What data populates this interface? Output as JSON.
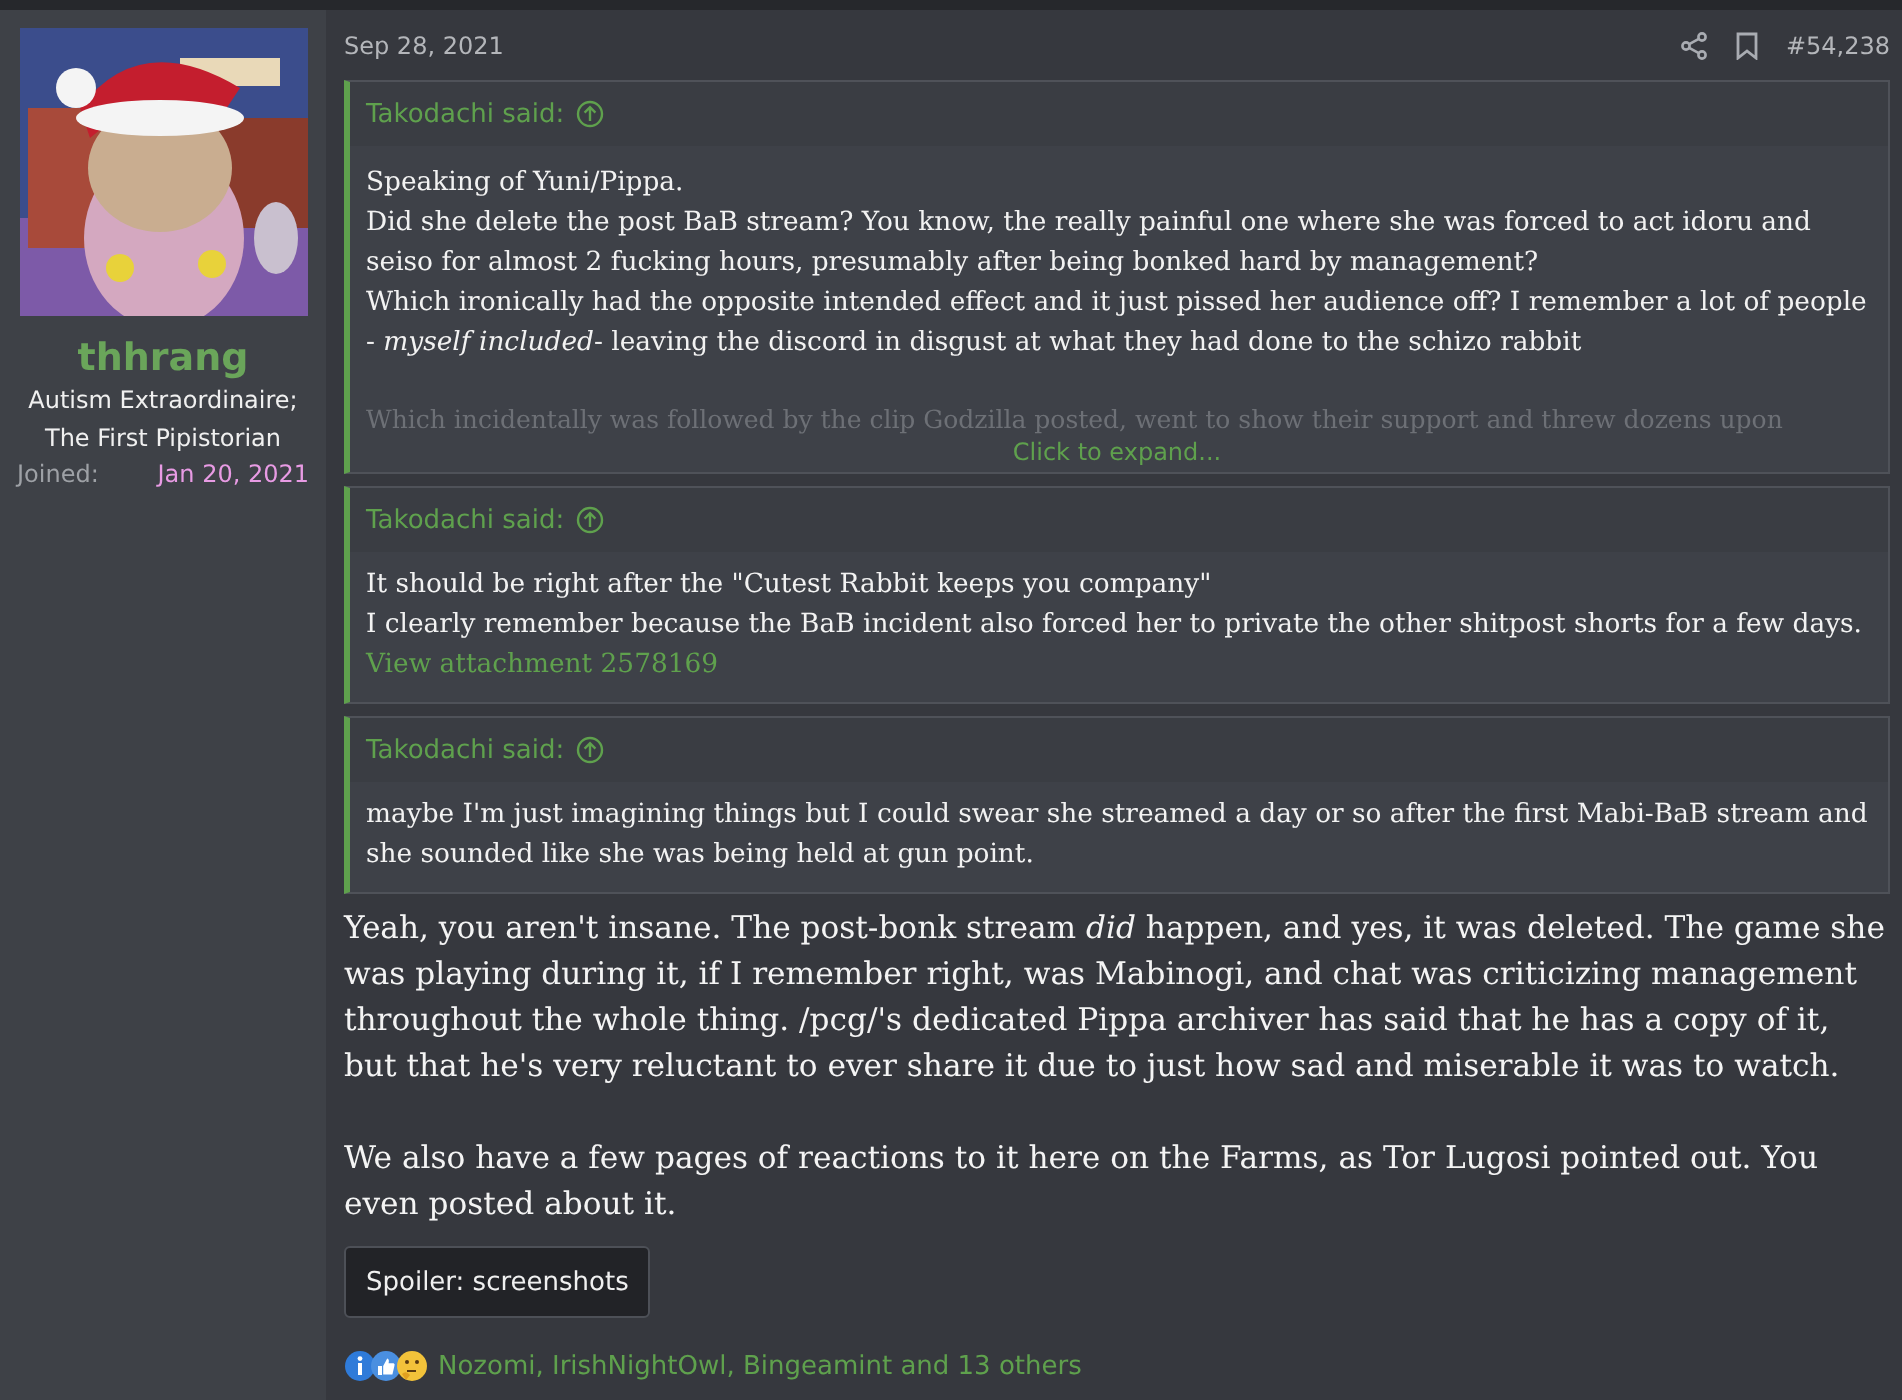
{
  "author": {
    "name": "thhrang",
    "title_lines": [
      "Autism Extraordinaire;",
      "The First Pipistorian"
    ],
    "joined_label": "Joined:",
    "joined_value": "Jan 20, 2021",
    "avatar": {
      "kind": "picture"
    }
  },
  "post": {
    "date": "Sep 28, 2021",
    "number": "#54,238",
    "quotes": [
      {
        "author": "Takodachi said:",
        "collapsed": true,
        "expand_label": "Click to expand...",
        "paragraphs": [
          [
            "Speaking of Yuni/Pippa.",
            "Did she delete the post BaB stream? You know, the really painful one where she was forced to act idoru and seiso for almost 2 fucking hours, presumably after being bonked hard by management?",
            "Which ironically had the opposite intended effect and it just pissed her audience off? I remember a lot of people - *myself included*- leaving the discord in disgust at what they had done to the schizo rabbit"
          ],
          [
            "Which incidentally was followed by the clip Godzilla posted, went to show their support and threw dozens upon"
          ]
        ]
      },
      {
        "author": "Takodachi said:",
        "collapsed": false,
        "paragraphs": [
          [
            "It should be right after the \"Cutest Rabbit keeps you company\"",
            "I clearly remember because the BaB incident also forced her to private the other shitpost shorts for a few days."
          ]
        ],
        "attachment_link": "View attachment 2578169"
      },
      {
        "author": "Takodachi said:",
        "collapsed": false,
        "paragraphs": [
          [
            "maybe I'm just imagining things but I could swear she streamed a day or so after the first Mabi-BaB stream and she sounded like she was being held at gun point."
          ]
        ]
      }
    ],
    "body": [
      "Yeah, you aren't insane. The post-bonk stream *did* happen, and yes, it was deleted. The game she was playing during it, if I remember right, was Mabinogi, and chat was criticizing management throughout the whole thing. /pcg/'s dedicated Pippa archiver has said that he has a copy of it, but that he's very reluctant to ever share it due to just how sad and miserable it was to watch.",
      "We also have a few pages of reactions to it here on the Farms, as Tor Lugosi pointed out. You even posted about it."
    ],
    "spoiler_button": "Spoiler: screenshots",
    "reactions": {
      "icons": [
        {
          "kind": "info"
        },
        {
          "kind": "like"
        },
        {
          "kind": "thinking"
        }
      ],
      "text": "Nozomi, IrishNightOwl, Bingeamint and 13 others"
    }
  }
}
